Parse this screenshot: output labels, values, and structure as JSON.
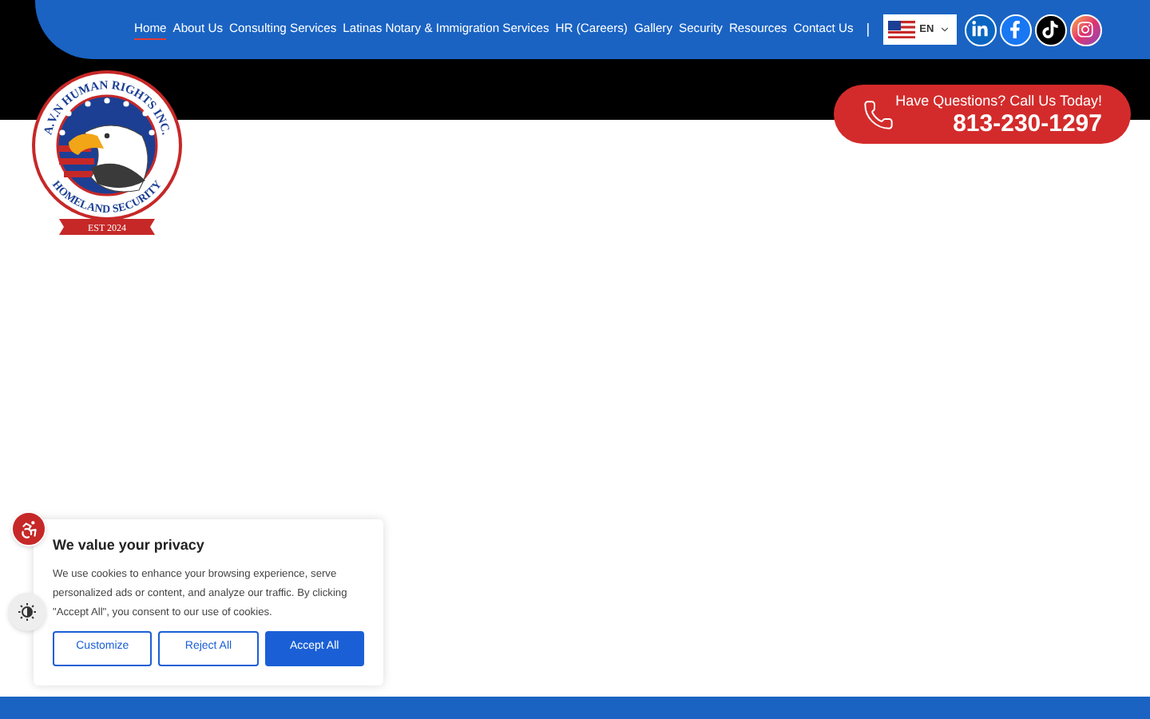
{
  "nav": {
    "items": [
      {
        "label": "Home",
        "selected": true
      },
      {
        "label": "About Us",
        "selected": false
      },
      {
        "label": "Consulting Services",
        "selected": false
      },
      {
        "label": "Latinas Notary & Immigration Services",
        "selected": false
      },
      {
        "label": "HR (Careers)",
        "selected": false
      },
      {
        "label": "Gallery",
        "selected": false
      },
      {
        "label": "Security",
        "selected": false
      },
      {
        "label": "Resources",
        "selected": false
      },
      {
        "label": "Contact Us",
        "selected": false
      }
    ],
    "separator": "|"
  },
  "language": {
    "code": "EN"
  },
  "social": [
    {
      "kind": "linkedin"
    },
    {
      "kind": "facebook"
    },
    {
      "kind": "tiktok"
    },
    {
      "kind": "instagram"
    }
  ],
  "logo": {
    "top_text": "A.V.N HUMAN RIGHTS INC.",
    "bottom_text": "HOMELAND SECURITY",
    "ribbon": "EST 2024"
  },
  "call": {
    "prompt": "Have Questions? Call Us Today!",
    "phone": "813-230-1297"
  },
  "cookie_banner": {
    "title": "We value your privacy",
    "text": "We use cookies to enhance your browsing experience, serve personalized ads or content, and analyze our traffic. By clicking \"Accept All\", you consent to our use of cookies.",
    "buttons": [
      {
        "label": "Customize",
        "kind": "outline"
      },
      {
        "label": "Reject All",
        "kind": "outline"
      },
      {
        "label": "Accept All",
        "kind": "primary"
      }
    ]
  }
}
